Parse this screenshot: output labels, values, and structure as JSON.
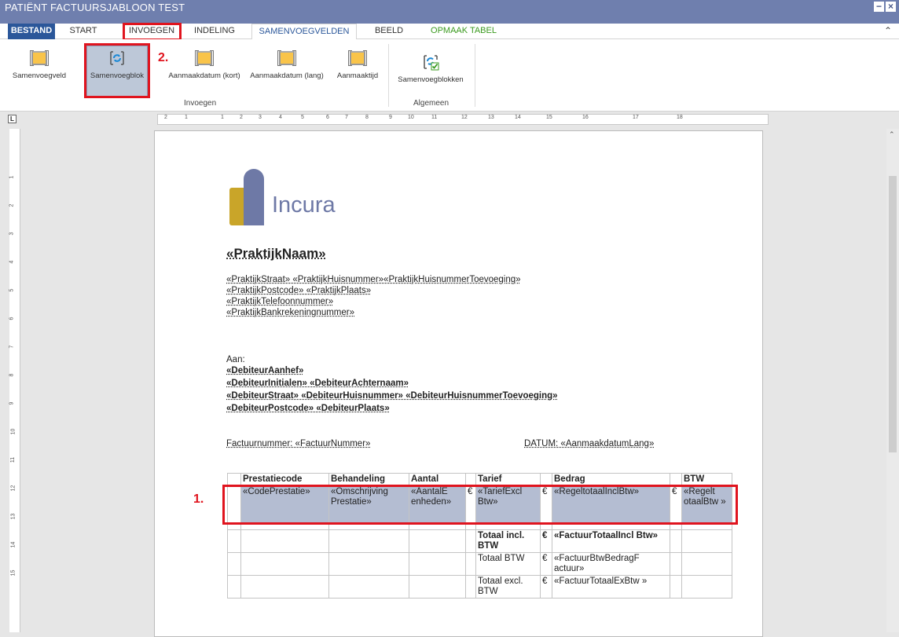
{
  "window": {
    "title": "PATIËNT FACTUURSJABLOON TEST"
  },
  "tabs": [
    {
      "label": "BESTAND"
    },
    {
      "label": "START"
    },
    {
      "label": "INVOEGEN"
    },
    {
      "label": "INDELING"
    },
    {
      "label": "SAMENVOEGVELDEN"
    },
    {
      "label": "BEELD"
    },
    {
      "label": "OPMAAK TABEL"
    }
  ],
  "ribbon": {
    "buttons": [
      {
        "label": "Samenvoegveld"
      },
      {
        "label": "Samenvoegblok"
      },
      {
        "label": "Aanmaakdatum (kort)"
      },
      {
        "label": "Aanmaakdatum (lang)"
      },
      {
        "label": "Aanmaaktijd"
      },
      {
        "label": "Samenvoegblokken"
      }
    ],
    "groups": [
      {
        "label": "Invoegen"
      },
      {
        "label": "Algemeen"
      }
    ],
    "annotation": "2."
  },
  "ruler": {
    "ticks": [
      "2",
      "1",
      "1",
      "2",
      "3",
      "4",
      "5",
      "6",
      "7",
      "8",
      "9",
      "10",
      "11",
      "12",
      "13",
      "14",
      "15",
      "16",
      "17",
      "18"
    ],
    "vticks": [
      "1",
      "2",
      "3",
      "4",
      "5",
      "6",
      "7",
      "8",
      "9",
      "10",
      "11",
      "12",
      "13",
      "14",
      "15"
    ]
  },
  "document": {
    "logo_text": "Incura",
    "practice_name": "«PraktijkNaam»",
    "practice_lines": [
      "«PraktijkStraat» «PraktijkHuisnummer»«PraktijkHuisnummerToevoeging»",
      "«PraktijkPostcode» «PraktijkPlaats»",
      "«PraktijkTelefoonnummer»",
      "«PraktijkBankrekeningnummer»"
    ],
    "to_label": "Aan:",
    "debtor_lines": [
      "«DebiteurAanhef»",
      "«DebiteurInitialen» «DebiteurAchternaam»",
      "«DebiteurStraat» «DebiteurHuisnummer» «DebiteurHuisnummerToevoeging»",
      "«DebiteurPostcode» «DebiteurPlaats»"
    ],
    "invoice_number": "Factuurnummer: «FactuurNummer»",
    "date": "DATUM: «AanmaakdatumLang»"
  },
  "table": {
    "headers": [
      "",
      "Prestatiecode",
      "Behandeling",
      "Aantal",
      "",
      "Tarief",
      "",
      "Bedrag",
      "",
      "BTW"
    ],
    "row": [
      "",
      "«CodePrestatie»",
      "«Omschrijving Prestatie»",
      "«AantalE enheden»",
      "€",
      "«TariefExcl Btw»",
      "€",
      "«RegeltotaalInclBtw»",
      "€",
      "«Regelt otaalBtw »"
    ],
    "totals": [
      {
        "label": "Totaal incl. BTW",
        "cur": "€",
        "value": "«FactuurTotaalIncl Btw»"
      },
      {
        "label": "Totaal BTW",
        "cur": "€",
        "value": "«FactuurBtwBedragF actuur»"
      },
      {
        "label": "Totaal excl. BTW",
        "cur": "€",
        "value": "«FactuurTotaalExBtw »"
      }
    ],
    "annotation": "1."
  }
}
